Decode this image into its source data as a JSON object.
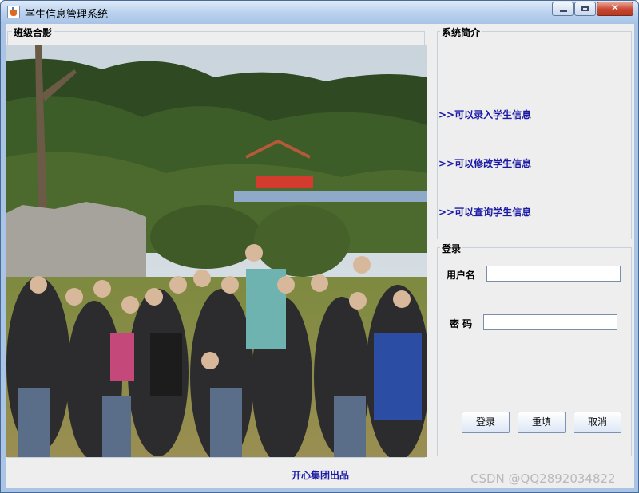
{
  "window": {
    "title": "学生信息管理系统",
    "icon": "java-cup-icon"
  },
  "photo_panel": {
    "label": "班级合影",
    "image": "class-group-photo"
  },
  "intro_panel": {
    "label": "系统简介",
    "items": [
      ">>可以录入学生信息",
      ">>可以修改学生信息",
      ">>可以查询学生信息"
    ]
  },
  "login_panel": {
    "label": "登录",
    "username_label": "用户名",
    "username_value": "",
    "password_label": "密 码",
    "password_value": "",
    "buttons": {
      "login": "登录",
      "reset": "重填",
      "cancel": "取消"
    }
  },
  "footer": "开心集团出品",
  "watermark": "CSDN @QQ2892034822",
  "colors": {
    "link_text": "#1a1aa6",
    "window_frame": "#a9c4e4",
    "client_bg": "#eeeeee"
  }
}
